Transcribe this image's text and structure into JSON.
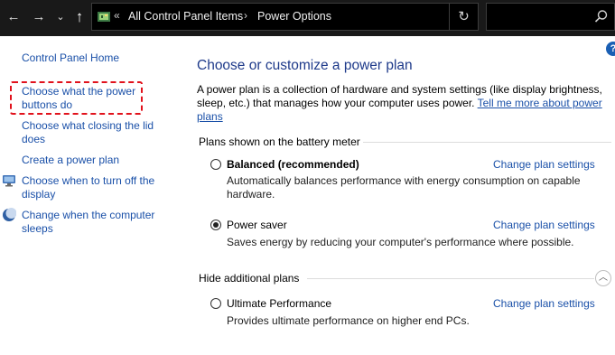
{
  "address_bar": {
    "crumb_overflow": "«",
    "crumbs": [
      "All Control Panel Items",
      "Power Options"
    ],
    "separator": "›"
  },
  "nav": {
    "back": "←",
    "forward": "→",
    "recent": "⌄",
    "up": "↑",
    "refresh": "↻"
  },
  "sidebar": {
    "items": [
      {
        "label": "Control Panel Home"
      },
      {
        "label": "Choose what the power buttons do",
        "line1": "Choose what the power",
        "line2": "buttons do",
        "highlighted": true
      },
      {
        "label": "Choose what closing the lid does",
        "line1": "Choose what closing the lid",
        "line2": "does"
      },
      {
        "label": "Create a power plan"
      },
      {
        "label": "Choose when to turn off the display",
        "line1": "Choose when to turn off the",
        "line2": "display",
        "icon": "monitor-icon"
      },
      {
        "label": "Change when the computer sleeps",
        "line1": "Change when the computer",
        "line2": "sleeps",
        "icon": "moon-icon"
      }
    ]
  },
  "main": {
    "heading": "Choose or customize a power plan",
    "intro_text": "A power plan is a collection of hardware and system settings (like display brightness, sleep, etc.) that manages how your computer uses power.",
    "intro_link": "Tell me more about power plans",
    "battery_group_label": "Plans shown on the battery meter",
    "hidden_group_label": "Hide additional plans",
    "change_label": "Change plan settings",
    "plans": [
      {
        "name": "Balanced (recommended)",
        "description": "Automatically balances performance with energy consumption on capable hardware.",
        "selected": false
      },
      {
        "name": "Power saver",
        "description": "Saves energy by reducing your computer's performance where possible.",
        "selected": true
      },
      {
        "name": "Ultimate Performance",
        "description": "Provides ultimate performance on higher end PCs.",
        "selected": false
      }
    ]
  },
  "help_label": "?",
  "colors": {
    "titlebar": "#191919",
    "link": "#1a50a8",
    "heading": "#1e3a8a",
    "highlight": "#e1121c"
  }
}
